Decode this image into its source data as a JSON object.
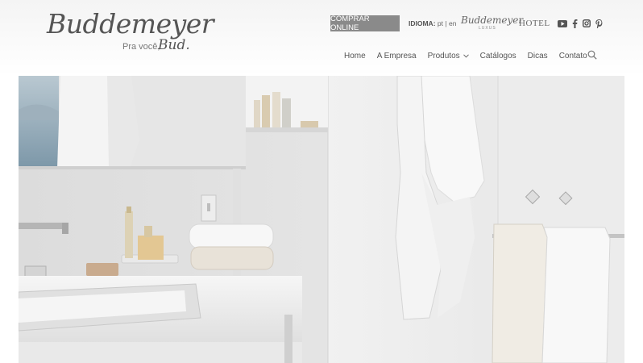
{
  "logo": {
    "name": "Buddemeyer",
    "tagline": "Pra você,",
    "sub_brand": "Bud."
  },
  "topbar": {
    "buy_button_label": "COMPRAR ONLINE",
    "language_label": "IDIOMA:",
    "languages": [
      "pt",
      "en"
    ],
    "language_separator": "|",
    "brand_luxus_name": "Buddemeyer",
    "brand_luxus_sub": "LUXUS",
    "brand_hotel": "HOTEL",
    "social": [
      "youtube-icon",
      "facebook-icon",
      "instagram-icon",
      "pinterest-icon"
    ]
  },
  "nav": {
    "items": [
      {
        "label": "Home"
      },
      {
        "label": "A Empresa"
      },
      {
        "label": "Produtos"
      },
      {
        "label": "Catálogos"
      },
      {
        "label": "Dicas"
      },
      {
        "label": "Contato"
      }
    ]
  },
  "hero": {
    "image": "bathroom-with-white-towels-and-bathrobe"
  },
  "colors": {
    "button_bg": "#8a8a8a",
    "text": "#555555",
    "header_bg": "#f4f4f4"
  }
}
